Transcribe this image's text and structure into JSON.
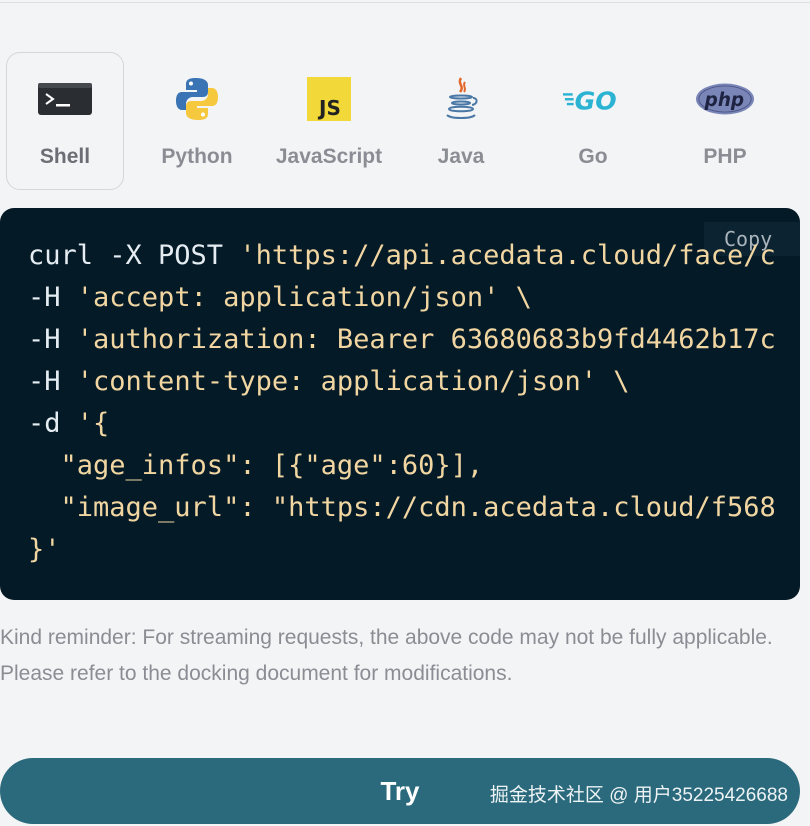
{
  "tabs": [
    {
      "label": "Shell",
      "icon": "terminal-icon",
      "active": true
    },
    {
      "label": "Python",
      "icon": "python-icon",
      "active": false
    },
    {
      "label": "JavaScript",
      "icon": "javascript-icon",
      "active": false
    },
    {
      "label": "Java",
      "icon": "java-icon",
      "active": false
    },
    {
      "label": "Go",
      "icon": "go-icon",
      "active": false
    },
    {
      "label": "PHP",
      "icon": "php-icon",
      "active": false
    }
  ],
  "code": {
    "copy_label": "Copy",
    "lines": [
      {
        "cmd": "curl -X POST ",
        "str": "'https://api.acedata.cloud/face/c"
      },
      {
        "cmd": "-H ",
        "str": "'accept: application/json' \\"
      },
      {
        "cmd": "-H ",
        "str": "'authorization: Bearer 63680683b9fd4462b17c"
      },
      {
        "cmd": "-H ",
        "str": "'content-type: application/json' \\"
      },
      {
        "cmd": "-d ",
        "str": "'{"
      },
      {
        "cmd": "",
        "str": "  \"age_infos\": [{\"age\":60}],"
      },
      {
        "cmd": "",
        "str": "  \"image_url\": \"https://cdn.acedata.cloud/f568"
      },
      {
        "cmd": "",
        "str": "}'"
      }
    ]
  },
  "reminder": {
    "text": "Kind reminder: For streaming requests, the above code may not be fully applicable. Please refer to the docking document for modifications."
  },
  "actions": {
    "try_label": "Try"
  },
  "watermark": {
    "text": "掘金技术社区 @ 用户35225426688"
  },
  "colors": {
    "code_bg": "#041a27",
    "button_bg": "#2a6a7c",
    "page_bg": "#f3f4f6"
  }
}
